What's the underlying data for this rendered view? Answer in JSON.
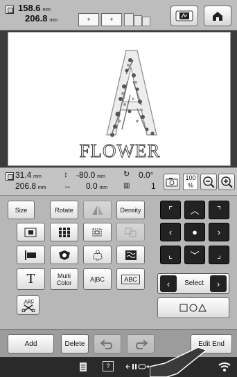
{
  "header": {
    "width_value": "158.6",
    "height_value": "206.8",
    "unit": "mm",
    "hoop_plus_1": "+",
    "hoop_plus_2": "+",
    "frame_icon": "hoop-frame-icon",
    "home_icon": "home-icon"
  },
  "canvas": {
    "letter": "A",
    "word": "FLOWER"
  },
  "info": {
    "size_w": "31.4",
    "size_h": "206.8",
    "unit": "mm",
    "pos_y": "-80.0",
    "pos_x": "0.0",
    "rotation": "0.0°",
    "color_count": "1",
    "zoom": "100",
    "zoom_unit": "%"
  },
  "edit": {
    "size_label": "Size",
    "rotate_label": "Rotate",
    "density_label": "Density",
    "multi_color_label_1": "Multi",
    "multi_color_label_2": "Color",
    "text_a_bc": "A|BC",
    "text_abc": "ABC",
    "select_label": "Select",
    "cut_label": "A̲B̲C̲"
  },
  "bottom": {
    "add_label": "Add",
    "delete_label": "Delete",
    "edit_end_label": "Edit End"
  },
  "colors": {
    "accent_dark": "#222222",
    "panel_bg": "#b7b7b7",
    "status_bg": "#2a2a2a"
  }
}
